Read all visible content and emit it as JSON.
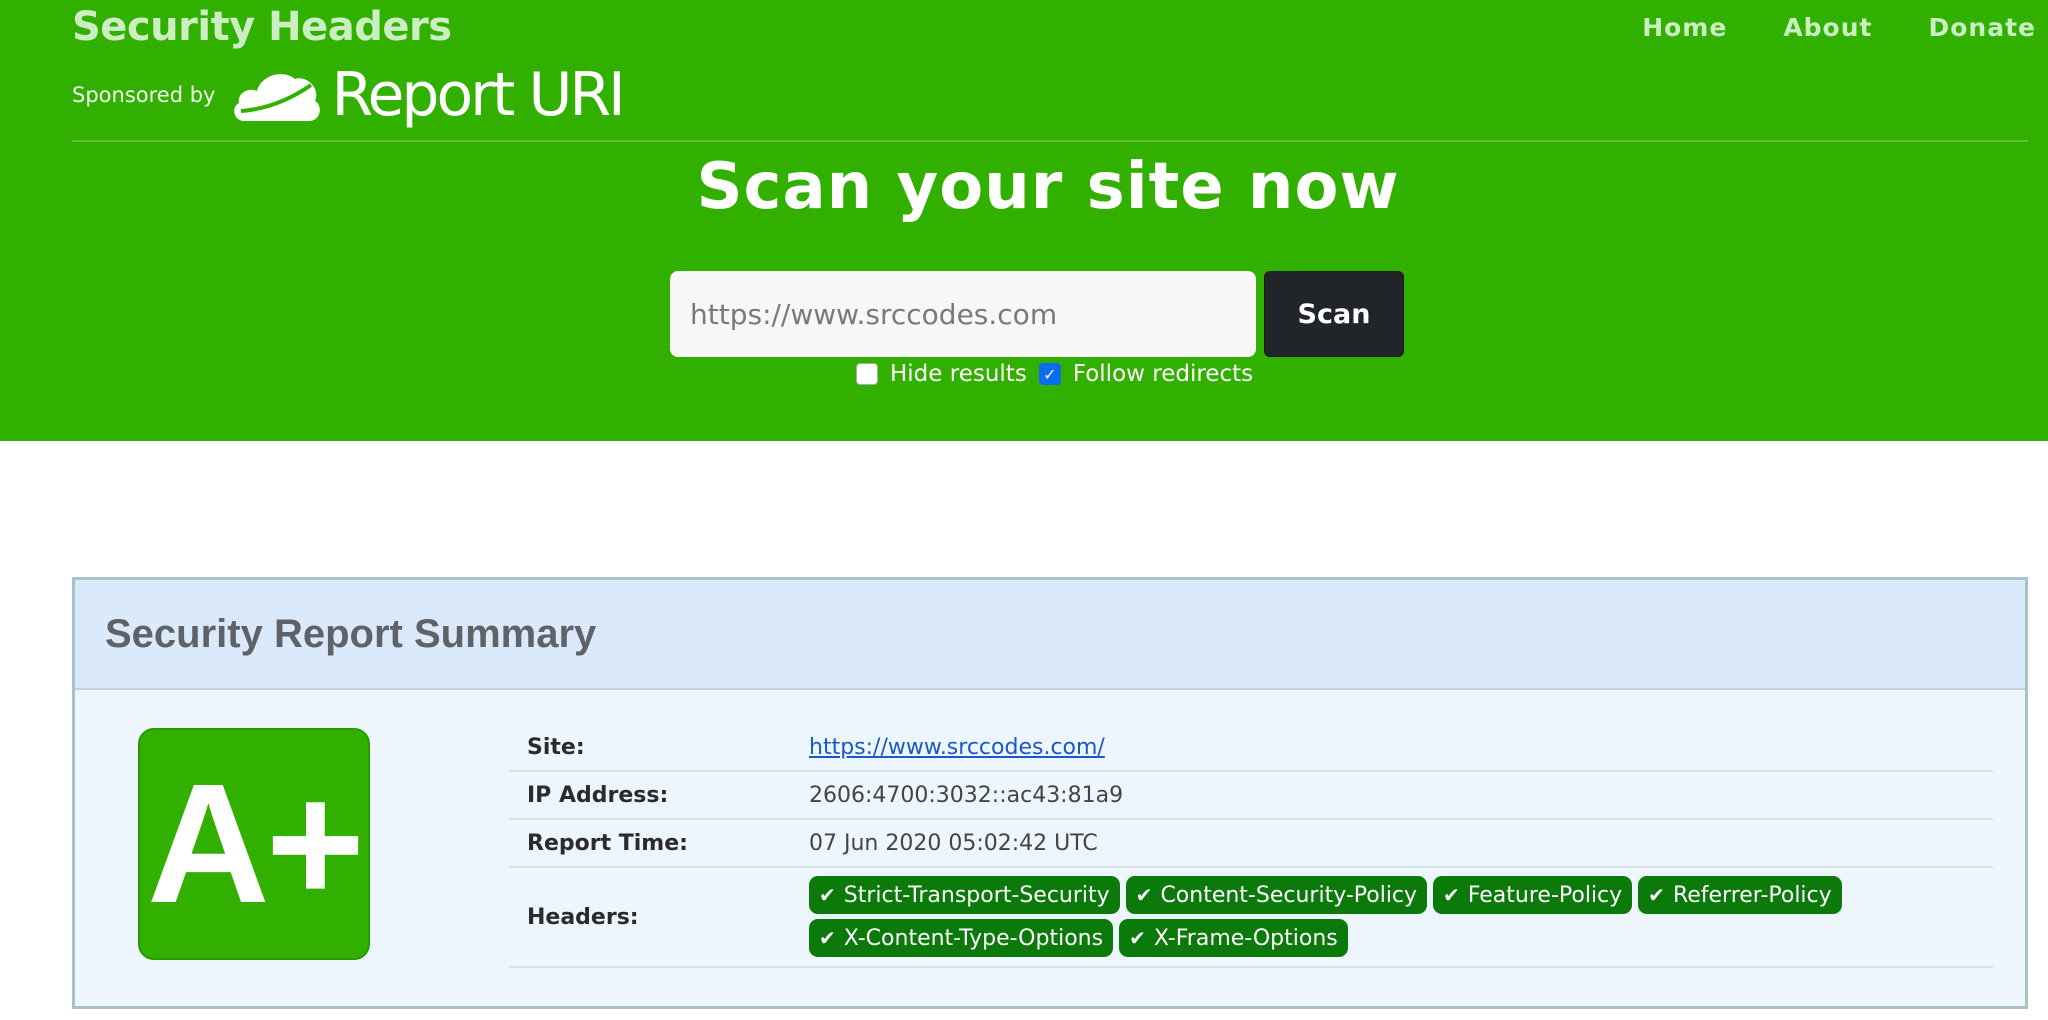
{
  "brand": {
    "title": "Security Headers",
    "sponsored_label": "Sponsored by",
    "sponsor_name": "Report URI",
    "sponsor_icon": "cloud-icon"
  },
  "nav": {
    "items": [
      {
        "label": "Home"
      },
      {
        "label": "About"
      },
      {
        "label": "Donate"
      }
    ]
  },
  "hero": {
    "heading": "Scan your site now",
    "search": {
      "value": "",
      "placeholder": "https://www.srccodes.com"
    },
    "scan_label": "Scan",
    "options": [
      {
        "label": "Hide results",
        "checked": false
      },
      {
        "label": "Follow redirects",
        "checked": true
      }
    ]
  },
  "report": {
    "title": "Security Report Summary",
    "grade": "A+",
    "grade_color": "#31b000",
    "rows": {
      "site": {
        "label": "Site:",
        "value": "https://www.srccodes.com/"
      },
      "ip": {
        "label": "IP Address:",
        "value": "2606:4700:3032::ac43:81a9"
      },
      "time": {
        "label": "Report Time:",
        "value": "07 Jun 2020 05:02:42 UTC"
      },
      "headers": {
        "label": "Headers:"
      }
    },
    "headers": [
      {
        "icon": "✔",
        "name": "Strict-Transport-Security"
      },
      {
        "icon": "✔",
        "name": "Content-Security-Policy"
      },
      {
        "icon": "✔",
        "name": "Feature-Policy"
      },
      {
        "icon": "✔",
        "name": "Referrer-Policy"
      },
      {
        "icon": "✔",
        "name": "X-Content-Type-Options"
      },
      {
        "icon": "✔",
        "name": "X-Frame-Options"
      }
    ],
    "badge_color": "#0b7a0b"
  },
  "colors": {
    "hero_bg": "#31b000",
    "button_dark": "#212529",
    "link": "#1a57c8"
  }
}
